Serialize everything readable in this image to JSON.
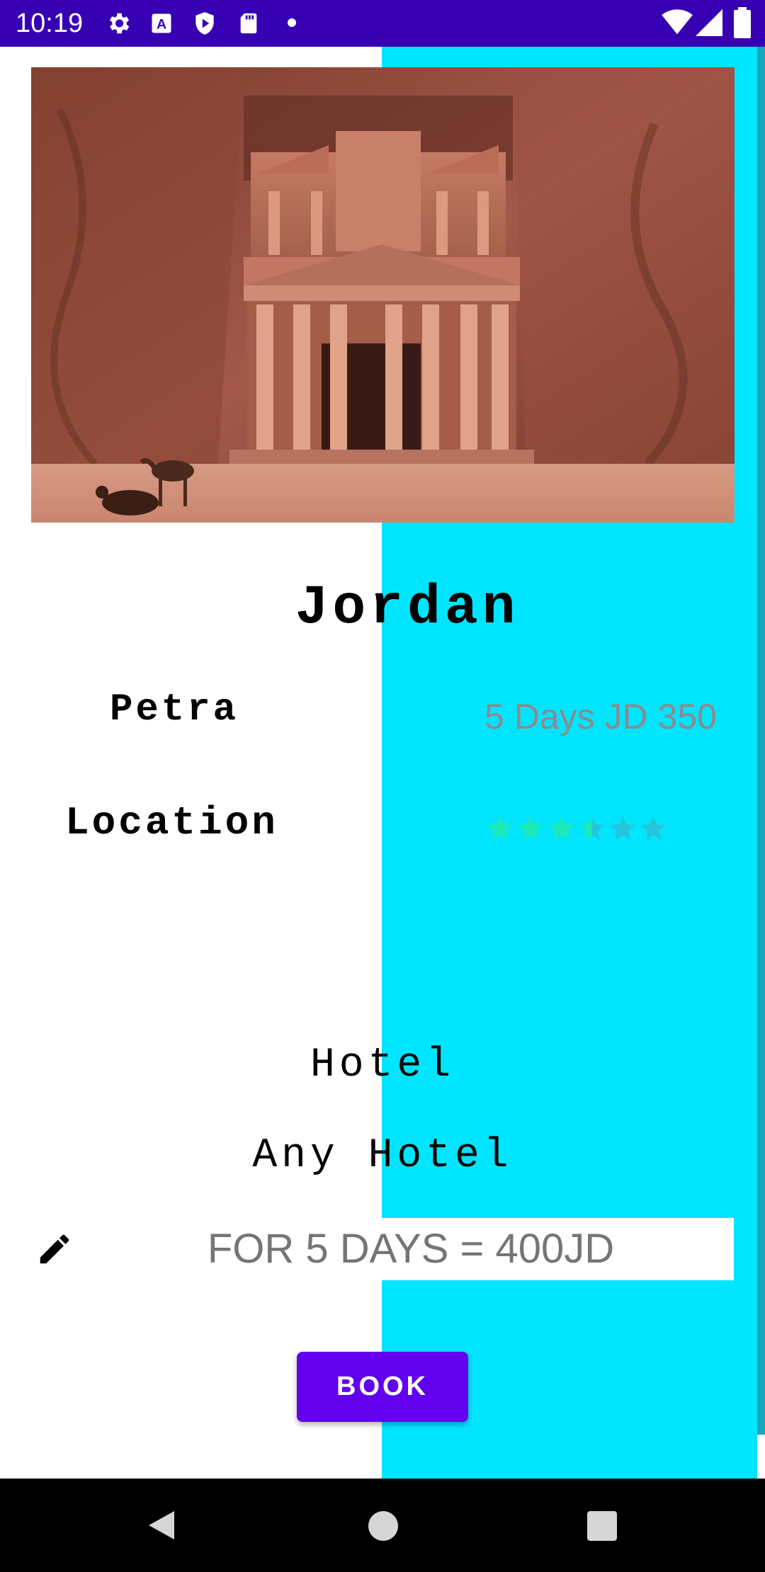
{
  "status_bar": {
    "time": "10:19",
    "icons": [
      "gear-icon",
      "a-icon",
      "shield-icon",
      "sd-card-icon",
      "dot-icon",
      "wifi-icon",
      "signal-icon",
      "battery-icon"
    ]
  },
  "destination": {
    "country": "Jordan",
    "place": "Petra",
    "price": "5 Days JD 350",
    "location_label": "Location",
    "rating": 3.5,
    "rating_max": 6
  },
  "hotel": {
    "label": "Hotel",
    "name": "Any Hotel",
    "cost": "FOR 5 DAYS = 400JD"
  },
  "actions": {
    "book_label": "BOOK"
  },
  "colors": {
    "status_bar": "#3700b3",
    "accent_panel": "#00e5ff",
    "button": "#6200ee",
    "star": "#1de9b6"
  }
}
